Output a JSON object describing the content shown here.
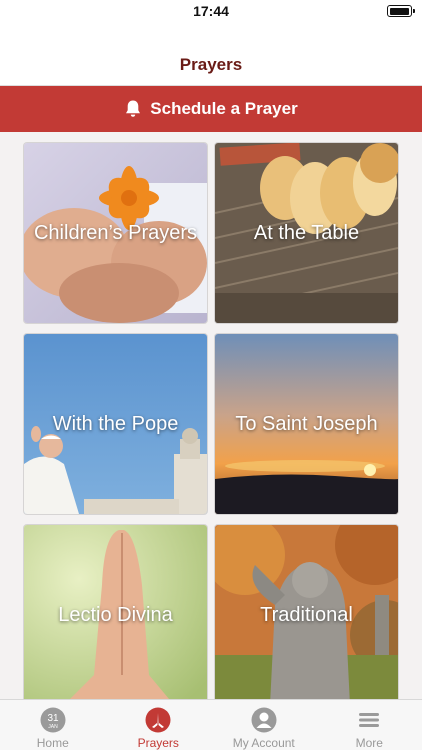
{
  "status_bar": {
    "time": "17:44"
  },
  "nav": {
    "title": "Prayers"
  },
  "schedule": {
    "label": "Schedule a Prayer"
  },
  "tiles": [
    {
      "label": "Children’s Prayers"
    },
    {
      "label": "At the Table"
    },
    {
      "label": "With the Pope"
    },
    {
      "label": "To Saint Joseph"
    },
    {
      "label": "Lectio Divina"
    },
    {
      "label": "Traditional"
    }
  ],
  "tab_bar": {
    "items": [
      {
        "label": "Home",
        "icon": "calendar-icon",
        "day": "31",
        "month": "JAN"
      },
      {
        "label": "Prayers",
        "icon": "praying-hands-icon",
        "active": true
      },
      {
        "label": "My Account",
        "icon": "user-icon"
      },
      {
        "label": "More",
        "icon": "menu-icon"
      }
    ]
  },
  "colors": {
    "accent": "#c23a35",
    "title": "#6a1b16"
  }
}
